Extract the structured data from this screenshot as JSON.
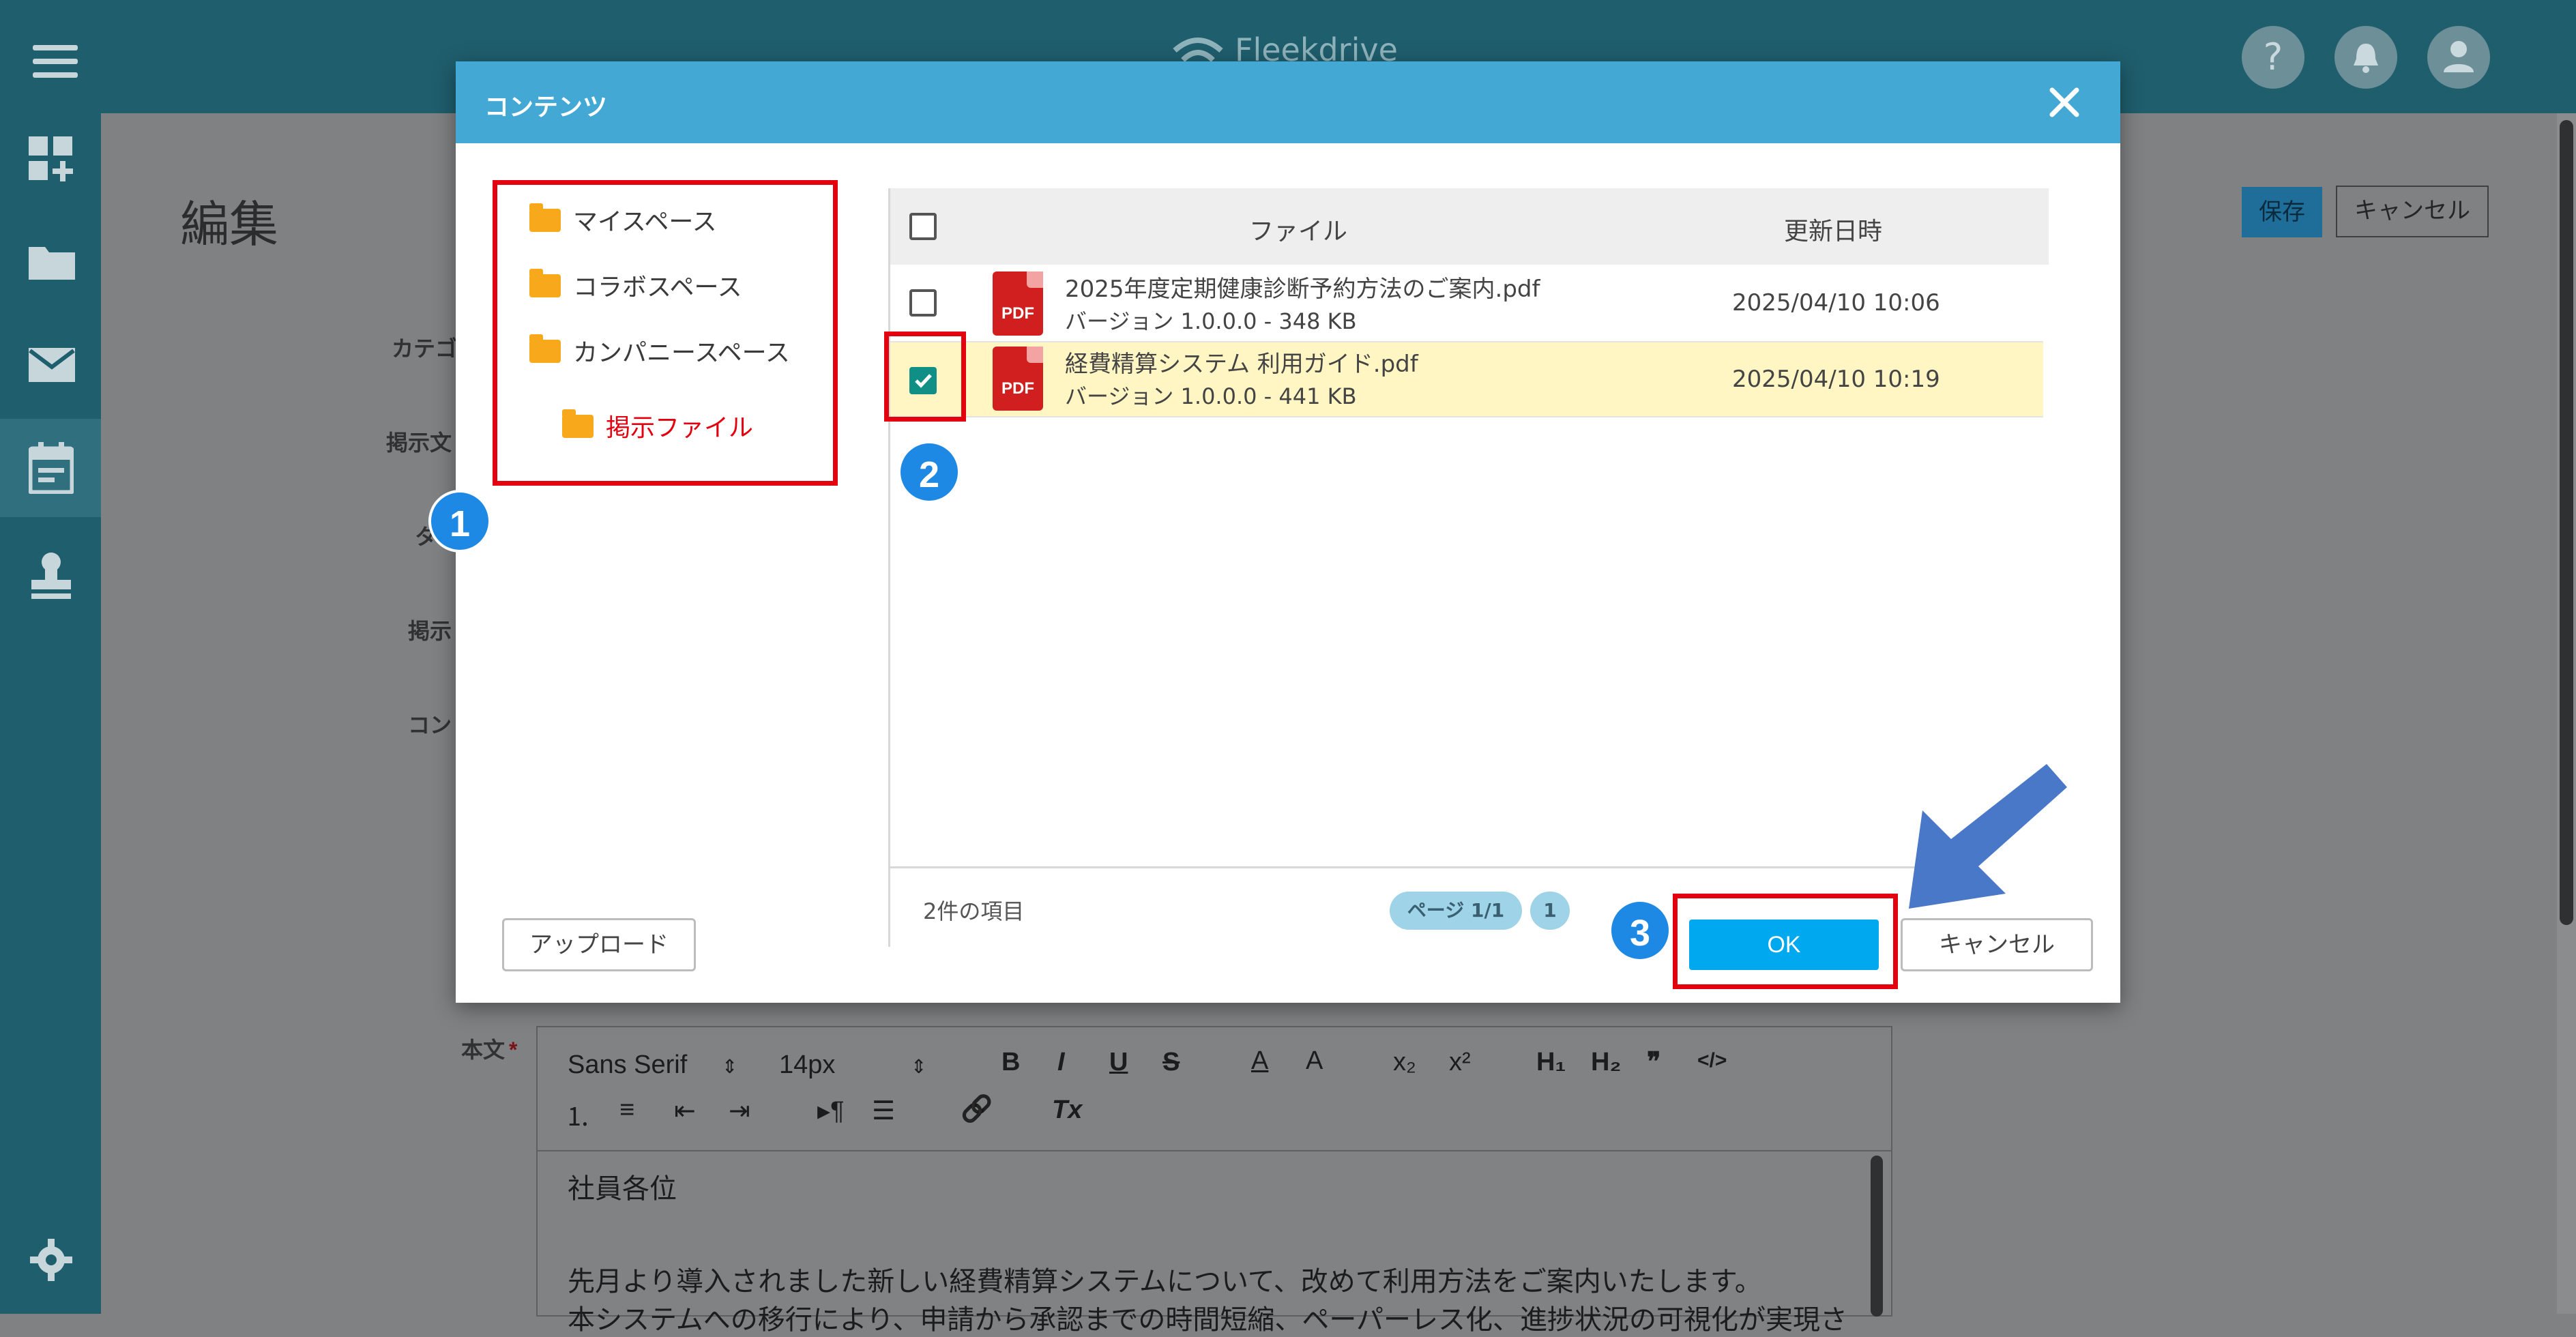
{
  "app": {
    "logo_text": "Fleekdrive"
  },
  "topbar": {
    "help_icon": "question-icon",
    "notification_icon": "bell-icon",
    "user_icon": "person-icon"
  },
  "sidebar": {
    "icons": [
      "menu-icon",
      "dashboard-add-icon",
      "folder-icon",
      "mail-icon",
      "calendar-icon",
      "stamp-icon",
      "gear-icon"
    ]
  },
  "background_page": {
    "title": "編集",
    "save_label": "保存",
    "cancel_label": "キャンセル",
    "field_labels": [
      "カテゴ",
      "掲示文",
      "タ",
      "掲示",
      "コン"
    ],
    "body_label": "本文",
    "required_mark": "*"
  },
  "editor": {
    "font_select": "Sans Serif",
    "size_select": "14px",
    "toolbar": {
      "bold": "B",
      "italic": "I",
      "underline": "U",
      "strike": "S",
      "font_color": "A",
      "background": "A",
      "subscript": "x₂",
      "superscript": "x²",
      "h1": "H₁",
      "h2": "H₂",
      "quote": "❞",
      "code": "</>",
      "ordered_list": "⒈",
      "bullet_list": "≡",
      "outdent": "⇤",
      "indent": "⇥",
      "rtl": "▸¶",
      "align": "☰",
      "link": "🔗",
      "clear": "Tx"
    },
    "lines": [
      "社員各位",
      "",
      "先月より導入されました新しい経費精算システムについて、改めて利用方法をご案内いたします。",
      "本システムへの移行により、申請から承認までの時間短縮、ペーパーレス化、進捗状況の可視化が実現さ"
    ]
  },
  "modal": {
    "title": "コンテンツ",
    "close_icon": "close-icon",
    "tree": [
      {
        "label": "マイスペース",
        "selected": false
      },
      {
        "label": "コラボスペース",
        "selected": false
      },
      {
        "label": "カンパニースペース",
        "selected": false
      },
      {
        "label": "掲示ファイル",
        "selected": true
      }
    ],
    "table": {
      "headers": {
        "file": "ファイル",
        "updated": "更新日時"
      },
      "rows": [
        {
          "name": "2025年度定期健康診断予約方法のご案内.pdf",
          "sub": "バージョン 1.0.0.0 - 348 KB",
          "date": "2025/04/10 10:06",
          "checked": false
        },
        {
          "name": "経費精算システム 利用ガイド.pdf",
          "sub": "バージョン 1.0.0.0 - 441 KB",
          "date": "2025/04/10 10:19",
          "checked": true
        }
      ],
      "pdf_label": "PDF",
      "count_label": "2件の項目",
      "page_label": "ページ 1/1",
      "page_number": "1"
    },
    "upload_label": "アップロード",
    "ok_label": "OK",
    "cancel_label": "キャンセル"
  },
  "annotations": {
    "badges": [
      "1",
      "2",
      "3"
    ],
    "highlight_color": "#e3000f",
    "arrow_color": "#4a78c8"
  },
  "colors": {
    "header_teal": "#1f5e6d",
    "modal_header": "#44a8d5",
    "ok_button": "#00a9ef",
    "selected_row": "#fff6c3",
    "folder": "#f7a81b",
    "pdf": "#d11f1f",
    "checkbox_checked": "#0f8f86",
    "selected_tree_text": "#e3000f"
  }
}
